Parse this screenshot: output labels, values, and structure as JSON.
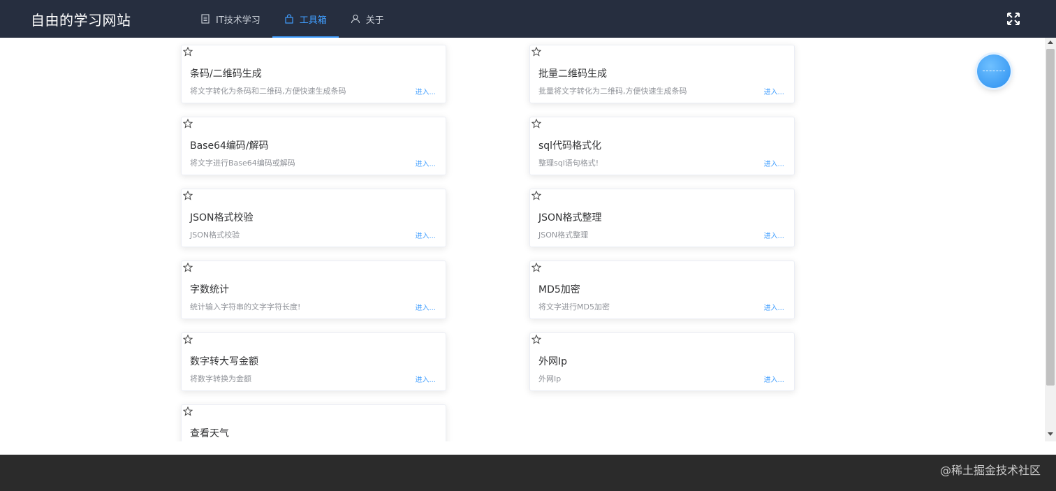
{
  "header": {
    "site_title": "自由的学习网站",
    "nav": [
      {
        "label": "IT技术学习",
        "icon": "document-icon",
        "active": false
      },
      {
        "label": "工具箱",
        "icon": "bag-icon",
        "active": true
      },
      {
        "label": "关于",
        "icon": "user-icon",
        "active": false
      }
    ],
    "fullscreen_icon": "expand-icon"
  },
  "tools": [
    {
      "title": "条码/二维码生成",
      "desc": "将文字转化为条码和二维码,方便快速生成条码",
      "enter": "进入..."
    },
    {
      "title": "批量二维码生成",
      "desc": "批量将文字转化为二维码,方便快速生成条码",
      "enter": "进入..."
    },
    {
      "title": "Base64编码/解码",
      "desc": "将文字进行Base64编码或解码",
      "enter": "进入..."
    },
    {
      "title": "sql代码格式化",
      "desc": "整理sql语句格式!",
      "enter": "进入..."
    },
    {
      "title": "JSON格式校验",
      "desc": "JSON格式校验",
      "enter": "进入..."
    },
    {
      "title": "JSON格式整理",
      "desc": "JSON格式整理",
      "enter": "进入..."
    },
    {
      "title": "字数统计",
      "desc": "统计输入字符串的文字字符长度!",
      "enter": "进入..."
    },
    {
      "title": "MD5加密",
      "desc": "将文字进行MD5加密",
      "enter": "进入..."
    },
    {
      "title": "数字转大写金额",
      "desc": "将数字转换为金额",
      "enter": "进入..."
    },
    {
      "title": "外网Ip",
      "desc": "外网Ip",
      "enter": "进入..."
    },
    {
      "title": "查看天气",
      "desc": "",
      "enter": ""
    }
  ],
  "footer": {
    "text": "@稀土掘金技术社区"
  },
  "colors": {
    "header_bg": "#262e3f",
    "accent": "#409eff",
    "footer_bg": "#2b2b2b"
  }
}
